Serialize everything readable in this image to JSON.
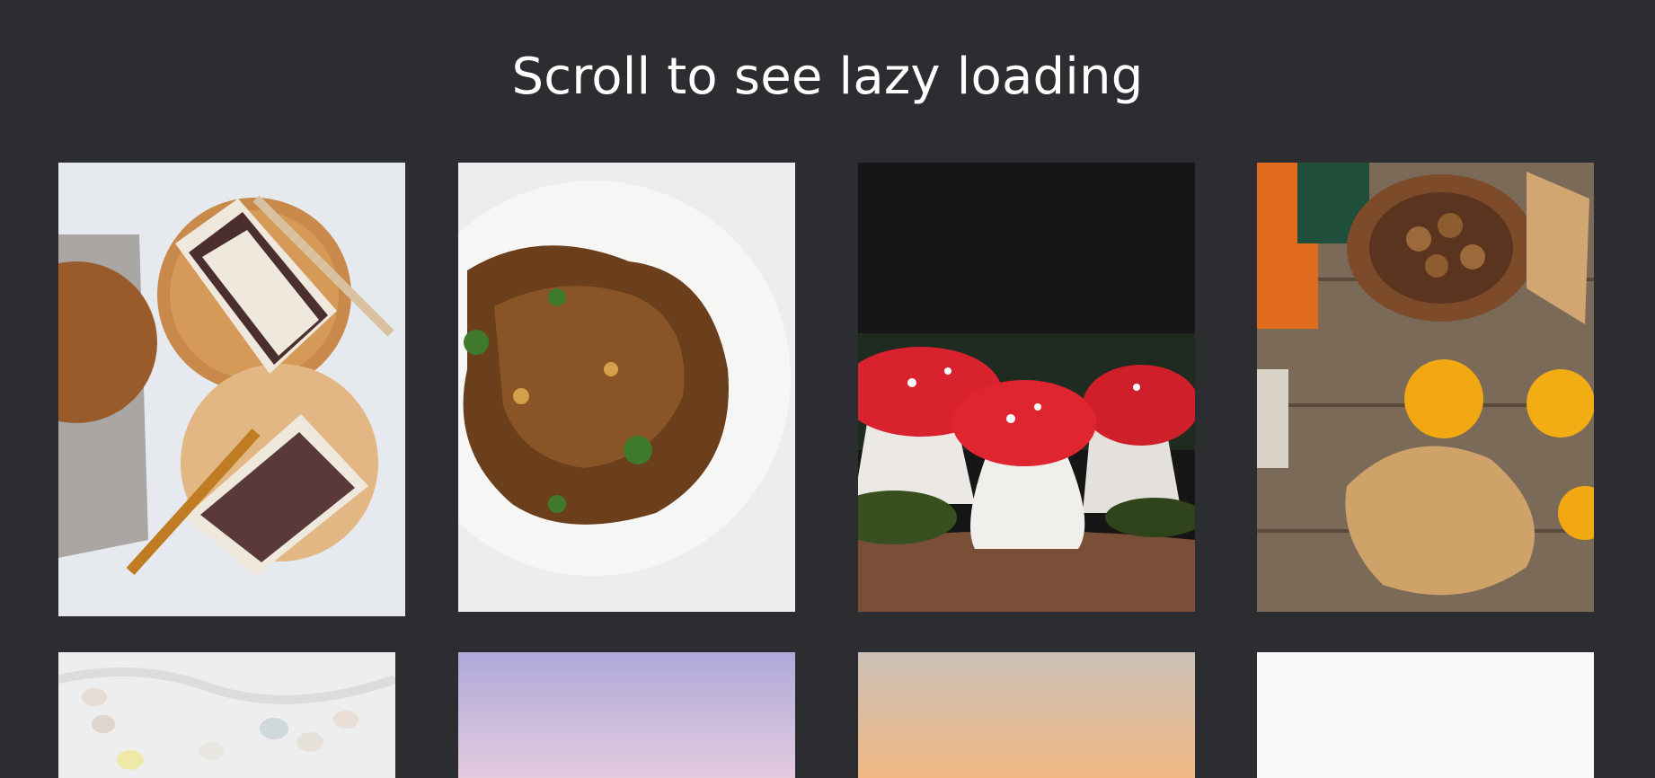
{
  "header": {
    "title": "Scroll to see lazy loading"
  },
  "gallery": {
    "images": [
      {
        "subject": "chocolate-layer-cake-slices",
        "palette": {
          "bg": "#e6e9ee",
          "plate": "#c8894a",
          "cake": "#5a3a38"
        }
      },
      {
        "subject": "glazed-walnut-dish",
        "palette": {
          "bg": "#ededee",
          "plate": "#f6f6f5",
          "food": "#6b3e1c"
        }
      },
      {
        "subject": "fly-agaric-mushrooms",
        "palette": {
          "bg": "#161616",
          "cap": "#d8222e",
          "stem": "#ece9e4"
        }
      },
      {
        "subject": "acorns-and-autumn-leaves",
        "palette": {
          "bg": "#7b6a58",
          "leaf": "#cfa26a",
          "citrus": "#f1a812"
        }
      },
      {
        "subject": "pastel-eggs-on-linen",
        "palette": {
          "bg": "#eeeeee"
        }
      },
      {
        "subject": "lavender-sky-gradient",
        "palette": {
          "top": "#aea9d9",
          "bottom": "#e4cbe0"
        }
      },
      {
        "subject": "peach-sunset-gradient",
        "palette": {
          "top": "#cbc0b6",
          "bottom": "#f0b783"
        }
      },
      {
        "subject": "blank-white",
        "palette": {
          "bg": "#fafafa"
        }
      }
    ]
  }
}
